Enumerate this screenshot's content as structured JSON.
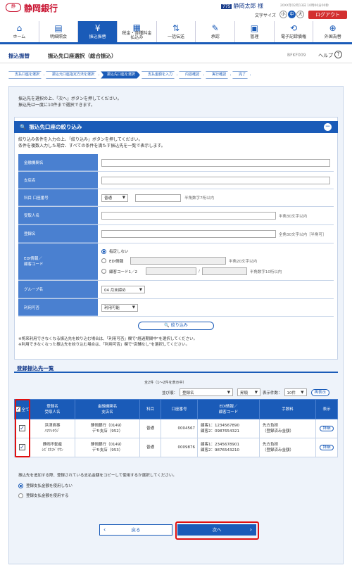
{
  "header": {
    "logo_text": "静",
    "bank_name": "静岡銀行",
    "user_badge": "775",
    "user_name": "静岡太郎 様",
    "datetime": "20XX年02月13日 10時00分00秒",
    "font_size_label": "文字サイズ",
    "font_small": "小",
    "font_medium": "中",
    "font_large": "大",
    "logout": "ログアウト"
  },
  "nav": [
    {
      "label": "ホーム",
      "icon": "⌂"
    },
    {
      "label": "明細照会",
      "icon": "▤"
    },
    {
      "label": "振込振替",
      "icon": "¥"
    },
    {
      "label": "税金・各種料金\n払込み",
      "icon": "▦"
    },
    {
      "label": "一括伝送",
      "icon": "⇅"
    },
    {
      "label": "承認",
      "icon": "✎"
    },
    {
      "label": "管理",
      "icon": "▣"
    },
    {
      "label": "電子記録債権",
      "icon": "⟲"
    },
    {
      "label": "外国為替",
      "icon": "⊕"
    }
  ],
  "title": {
    "section": "振込振替",
    "page": "振込先口座選択（総合振込）",
    "code": "BFKF009",
    "help": "ヘルプ"
  },
  "steps": [
    "支払口座を選択",
    "振込元口座指定方法を選択",
    "振込先口座を選択",
    "支払金額を入力",
    "内容確認",
    "実行確認",
    "完了"
  ],
  "intro": {
    "line1": "振込先を選択の上、「次へ」ボタンを押してください。",
    "line2": "振込先は一度に10件まで選択できます。"
  },
  "filter": {
    "title": "振込先口座の絞り込み",
    "desc1": "絞り込み条件を入力の上、「絞り込み」ボタンを押してください。",
    "desc2": "条件を複数入力した場合、すべての条件を満たす振込先を一覧で表示します。",
    "labels": {
      "bank": "金融機関名",
      "branch": "支店名",
      "account": "科目 口座番号",
      "recipient": "受取人名",
      "registered": "登録名",
      "edi": "EDI情報／\n顧客コード",
      "group": "グループ名",
      "usable": "利用可否"
    },
    "account_type": "普通",
    "account_hint": "半角数字7桁以内",
    "recipient_hint": "半角30文字以内",
    "registered_hint": "全角30文字以内［半角可］",
    "edi_opt1": "指定しない",
    "edi_opt2": "EDI情報",
    "edi_opt2_hint": "半角20文字以内",
    "edi_opt3": "顧客コード1／2",
    "edi_opt3_hint": "半角数字10桁以内",
    "group_value": "04 月末締め",
    "usable_value": "利用可能",
    "search_button": "絞り込み",
    "note1": "※将来利用できなくなる振込先を絞り込む場合は、「利用可否」欄で\"経過期間中\"を選択してください。",
    "note2": "※利用できなくなった振込先を絞り込む場合は、「利用可否」欄で\"店舗なし\"を選択してください。"
  },
  "list": {
    "title": "登録振込先一覧",
    "count": "全2件（1～2件を表示中）",
    "sort_label": "並び順：",
    "sort_value": "登録名",
    "order_value": "昇順",
    "per_page_label": "表示件数：",
    "per_page_value": "10件",
    "show_button": "再表示",
    "headers": {
      "all": "全て",
      "name": "登録名\n受取人名",
      "bank": "金融機関名\n支店名",
      "type": "科目",
      "account": "口座番号",
      "edi": "EDI情報／\n顧客コード",
      "fee": "手数料",
      "show": "表示"
    },
    "rows": [
      {
        "name1": "浜津商事",
        "name2": "ﾊﾏﾂｼﾖｳｼﾞ",
        "bank1": "静岡銀行（0149）",
        "bank2": "デモ支店（952）",
        "type": "普通",
        "account": "0004567",
        "edi1": "顧客1：1234567890",
        "edi2": "顧客2：0987654321",
        "fee1": "先方負担",
        "fee2": "（登録済み金額）",
        "detail": "詳細"
      },
      {
        "name1": "静岡不動産",
        "name2": "ｼｽﾞｵｶﾌﾄﾞｳｻﾝ",
        "bank1": "静岡銀行（0149）",
        "bank2": "デモ支店（953）",
        "type": "普通",
        "account": "0009876",
        "edi1": "顧客1：2345678901",
        "edi2": "顧客2：9876543210",
        "fee1": "先方負担",
        "fee2": "（登録済み金額）",
        "detail": "詳細"
      }
    ]
  },
  "payment": {
    "desc": "振込先を追加する際、登録されている支払金額をコピーして使用するか選択してください。",
    "opt1": "登録支払金額を使用しない",
    "opt2": "登録支払金額を使用する"
  },
  "buttons": {
    "back": "戻る",
    "next": "次へ"
  }
}
